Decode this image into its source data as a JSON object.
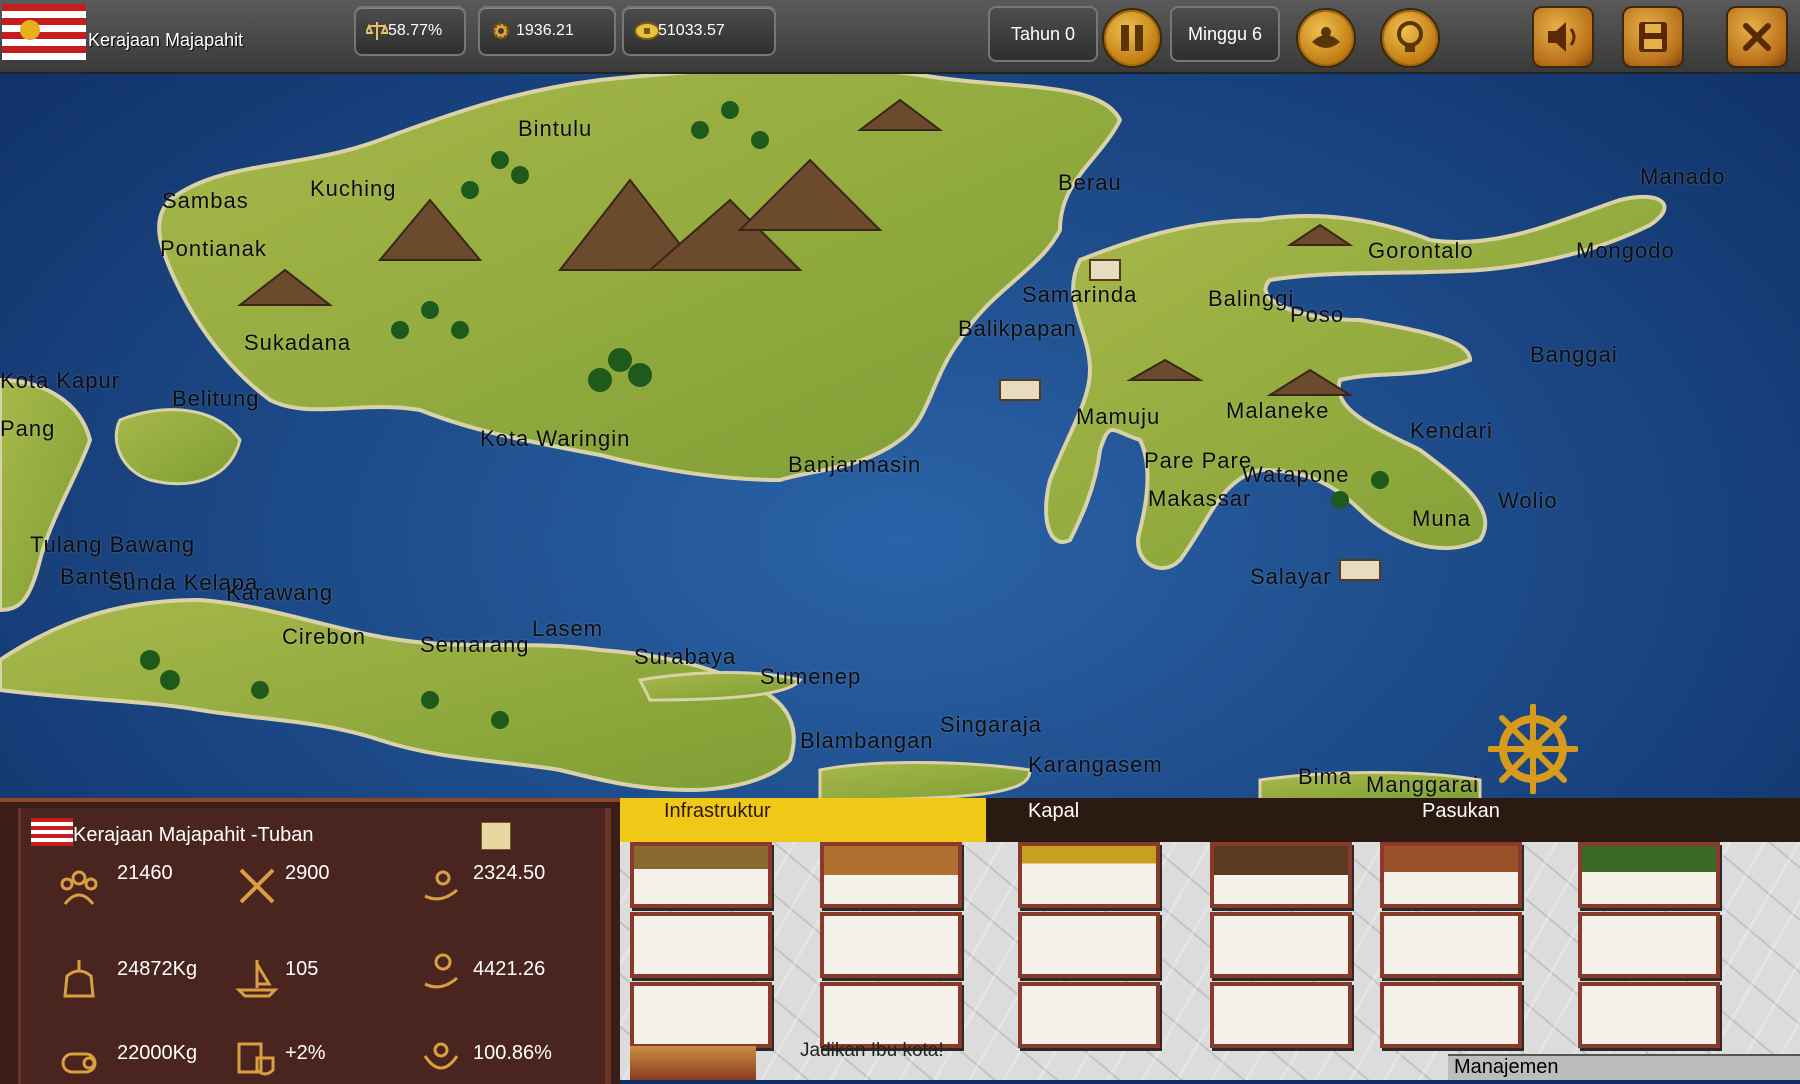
{
  "top_bar": {
    "kingdom_name": "Kerajaan Majapahit",
    "stability": "58.77%",
    "production": "1936.21",
    "gold": "51033.57",
    "year": "Tahun 0",
    "week": "Minggu 6",
    "icons": [
      "stability-icon",
      "gear-icon",
      "coin-icon",
      "pause-icon",
      "diplomacy-icon",
      "idea-icon",
      "sound-icon",
      "save-icon",
      "close-icon"
    ]
  },
  "map": {
    "cities": [
      "Bintulu",
      "Sambas",
      "Kuching",
      "Pontianak",
      "Sukadana",
      "Kota Kapur",
      "Belitung",
      "Kota Waringin",
      "Banjarmasin",
      "Berau",
      "Samarinda",
      "Balikpapan",
      "Mamuju",
      "Pare Pare",
      "Makassar",
      "Salayar",
      "Gorontalo",
      "Balinggi",
      "Poso",
      "Mongodo",
      "Manado",
      "Banggai",
      "Malaneke",
      "Kendari",
      "Watapone",
      "Wolio",
      "Muna",
      "Tulang Bawang",
      "Banten",
      "Sunda Kelapa",
      "Karawang",
      "Cirebon",
      "Semarang",
      "Lasem",
      "Surabaya",
      "Sumenep",
      "Blambangan",
      "Singaraja",
      "Karangasem",
      "Bima",
      "Manggarai",
      "Pang"
    ]
  },
  "info_panel": {
    "title": "Kerajaan Majapahit  -Tuban",
    "population": "21460",
    "soldiers": "2900",
    "income": "2324.50",
    "food": "24872Kg",
    "ships": "105",
    "trade": "4421.26",
    "wood": "22000Kg",
    "defense": "+2%",
    "loyalty": "100.86%"
  },
  "management": {
    "tabs": [
      "Infrastruktur",
      "Kapal",
      "Pasukan"
    ],
    "active_tab": "Infrastruktur",
    "capital_button": "Jadikan Ibu kota!",
    "manage_label": "Manajemen"
  },
  "colors": {
    "accent": "#f0c818",
    "panel": "#4a241e",
    "sea": "#1c4d8c",
    "land": "#8fae3a"
  }
}
